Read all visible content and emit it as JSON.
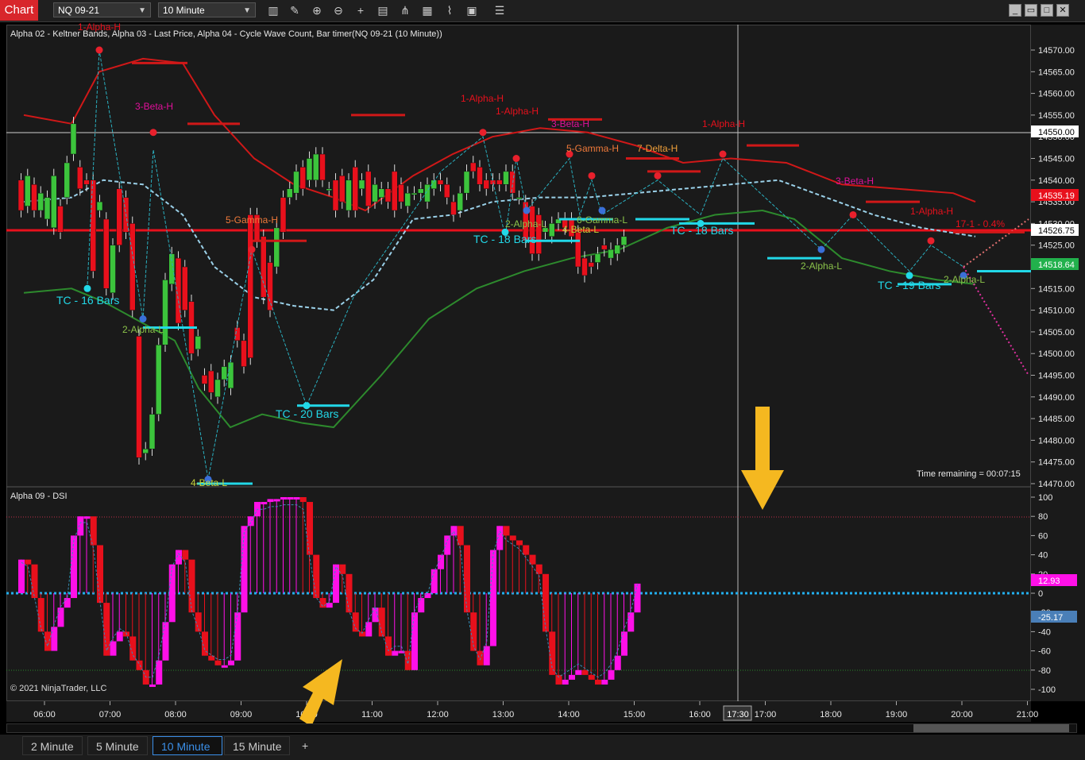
{
  "toolbar": {
    "chart_tab": "Chart",
    "instrument": "NQ 09-21",
    "interval": "10 Minute",
    "tools": [
      "bars-icon",
      "pencil-icon",
      "zoom-in-icon",
      "zoom-out-icon",
      "crosshair-icon",
      "properties-icon",
      "indicator-icon",
      "strategy-icon",
      "data-box-icon",
      "overflow-icon"
    ]
  },
  "main_panel": {
    "title": "Alpha 02 - Keltner Bands, Alpha 03 - Last Price, Alpha 04 - Cycle Wave Count, Bar timer(NQ 09-21 (10 Minute))",
    "time_remaining": "Time remaining = 00:07:15",
    "price_ticks": [
      "14570.00",
      "14565.00",
      "14560.00",
      "14555.00",
      "14550.00",
      "14545.00",
      "14540.00",
      "14535.00",
      "14530.00",
      "14525.00",
      "14520.00",
      "14515.00",
      "14510.00",
      "14505.00",
      "14500.00",
      "14495.00",
      "14490.00",
      "14485.00",
      "14480.00",
      "14475.00",
      "14470.00"
    ],
    "price_markers": [
      {
        "value": "14550.00",
        "color": "#ffffff",
        "text_color": "#000000"
      },
      {
        "value": "14535.19",
        "color": "#e8101c",
        "text_color": "#ffffff"
      },
      {
        "value": "14526.75",
        "color": "#ffffff",
        "text_color": "#000000"
      },
      {
        "value": "14518.64",
        "color": "#22b14c",
        "text_color": "#ffffff"
      }
    ],
    "wave_labels": [
      {
        "text": "1-Alpha-H",
        "color": "#e8101c"
      },
      {
        "text": "3-Beta-H",
        "color": "#e0109a"
      },
      {
        "text": "5-Gamma-H",
        "color": "#f07a3a"
      },
      {
        "text": "1-Alpha-H",
        "color": "#e8101c"
      },
      {
        "text": "1-Alpha-H",
        "color": "#e8101c"
      },
      {
        "text": "3-Beta-H",
        "color": "#e0109a"
      },
      {
        "text": "5-Gamma-H",
        "color": "#f07a3a"
      },
      {
        "text": "7-Delta-H",
        "color": "#f0a03a"
      },
      {
        "text": "1-Alpha-H",
        "color": "#e8101c"
      },
      {
        "text": "3-Beta-H",
        "color": "#e0109a"
      },
      {
        "text": "1-Alpha-H",
        "color": "#e8101c"
      },
      {
        "text": "17-1 - 0.4%",
        "color": "#e8101c"
      },
      {
        "text": "2-Alpha-L",
        "color": "#8bc34a"
      },
      {
        "text": "4-Beta-L",
        "color": "#c6d43a"
      },
      {
        "text": "2-Alpha-L",
        "color": "#8bc34a"
      },
      {
        "text": "4-Beta-L",
        "color": "#c6d43a"
      },
      {
        "text": "6-Gamma-L",
        "color": "#8bc34a"
      },
      {
        "text": "2-Alpha-L",
        "color": "#8bc34a"
      },
      {
        "text": "2-Alpha-L",
        "color": "#8bc34a"
      }
    ],
    "tc_labels": [
      "TC - 16 Bars",
      "TC - 20 Bars",
      "TC - 18 Bars",
      "TC - 18 Bars",
      "TC - 19 Bars"
    ]
  },
  "dsi_panel": {
    "title": "Alpha 09 - DSI",
    "ticks": [
      "100",
      "80",
      "60",
      "40",
      "20",
      "0",
      "-20",
      "-40",
      "-60",
      "-80",
      "-100"
    ],
    "value_markers": [
      {
        "value": "12.93",
        "color": "#ff10e8"
      },
      {
        "value": "-25.17",
        "color": "#4a7fb8"
      }
    ],
    "copyright": "© 2021 NinjaTrader, LLC"
  },
  "time_axis": {
    "ticks": [
      "06:00",
      "07:00",
      "08:00",
      "09:00",
      "10:00",
      "11:00",
      "12:00",
      "13:00",
      "14:00",
      "15:00",
      "16:00",
      "17:00",
      "18:00",
      "19:00",
      "20:00",
      "21:00"
    ],
    "cursor_time": "17:30"
  },
  "bottom_tabs": [
    {
      "label": "2 Minute",
      "active": false
    },
    {
      "label": "5 Minute",
      "active": false
    },
    {
      "label": "10 Minute",
      "active": true
    },
    {
      "label": "15 Minute",
      "active": false
    },
    {
      "label": "+",
      "active": false
    }
  ],
  "colors": {
    "bull": "#3cc43c",
    "bear": "#e8101c",
    "upper_band": "#d01818",
    "lower_band": "#2d8a2d",
    "mid_band": "#9ad0e8",
    "cyan": "#22d8e8",
    "dsi_pos": "#ff10e8",
    "dsi_neg": "#e8101c",
    "arrow": "#f5b820"
  }
}
